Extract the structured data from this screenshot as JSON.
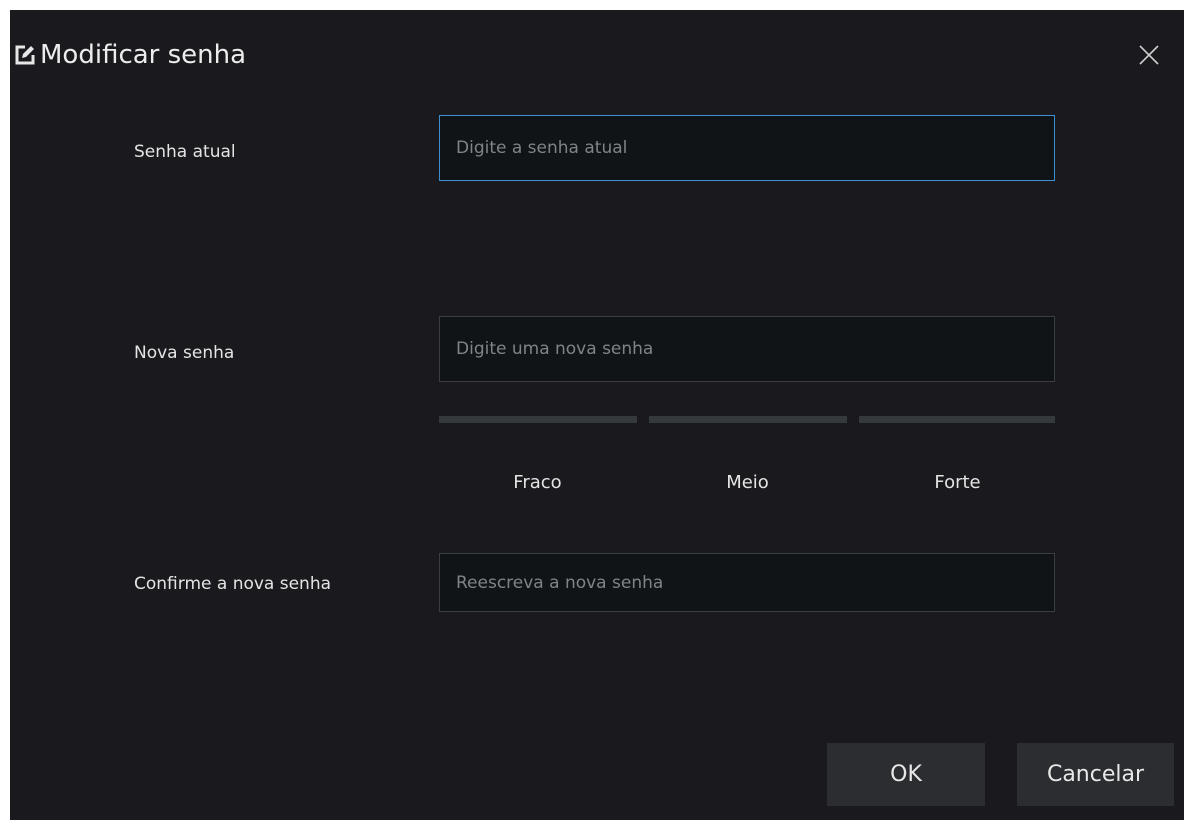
{
  "dialog": {
    "title": "Modificar senha",
    "title_icon": "edit-icon",
    "close_icon": "close-icon"
  },
  "fields": {
    "current_password": {
      "label": "Senha atual",
      "placeholder": "Digite a senha atual",
      "value": ""
    },
    "new_password": {
      "label": "Nova senha",
      "placeholder": "Digite uma nova senha",
      "value": ""
    },
    "confirm_password": {
      "label": "Confirme a nova senha",
      "placeholder": "Reescreva a nova senha",
      "value": ""
    }
  },
  "strength": {
    "levels": [
      "Fraco",
      "Meio",
      "Forte"
    ],
    "empty_color": "#34393b"
  },
  "buttons": {
    "ok": "OK",
    "cancel": "Cancelar"
  },
  "colors": {
    "background": "#1a1a1e",
    "input_background": "#101416",
    "focus_border": "#3d8fd4",
    "button_background": "#2b2d31"
  }
}
